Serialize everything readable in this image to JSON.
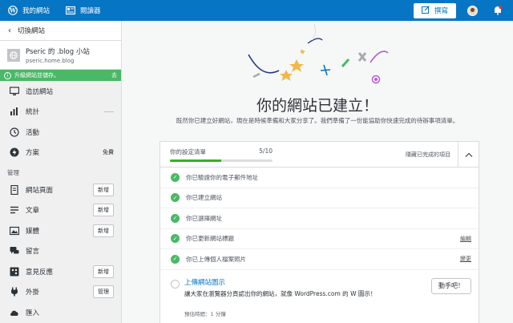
{
  "masterbar": {
    "my_site": "我的網站",
    "reader": "閱讀器",
    "write": "撰寫"
  },
  "sidebar": {
    "switch_site": "切換網站",
    "site_name": "Pseric 的 .blog 小站",
    "site_url": "pseric.home.blog",
    "upgrade_label": "升級網站並儲存。",
    "upgrade_action": "去",
    "items_top": [
      {
        "label": "造訪網站",
        "icon": "monitor-icon"
      },
      {
        "label": "統計",
        "icon": "stats-icon"
      },
      {
        "label": "活動",
        "icon": "activity-icon"
      },
      {
        "label": "方案",
        "icon": "plans-icon",
        "badge": "免費"
      }
    ],
    "manage_heading": "管理",
    "items_manage": [
      {
        "label": "網站頁面",
        "icon": "pages-icon",
        "button": "新增"
      },
      {
        "label": "文章",
        "icon": "posts-icon",
        "button": "新增"
      },
      {
        "label": "媒體",
        "icon": "media-icon",
        "button": "新增"
      },
      {
        "label": "留言",
        "icon": "comments-icon"
      },
      {
        "label": "意見反應",
        "icon": "feedback-icon",
        "button": "新增"
      },
      {
        "label": "外掛",
        "icon": "plugins-icon",
        "button": "管理"
      },
      {
        "label": "匯入",
        "icon": "import-icon"
      }
    ]
  },
  "main": {
    "headline": "你的網站已建立！",
    "subline": "既然你已建立好網站，現在是時候準備和大家分享了。我們準備了一份能協助你快速完成的待辦事項清單。",
    "checklist": {
      "title": "你的設定清單",
      "progress_text": "5/10",
      "progress_fraction": 0.5,
      "hide_label": "隱藏已完成的項目",
      "tasks_done": [
        {
          "text": "你已驗證你的電子郵件地址",
          "action": ""
        },
        {
          "text": "你已建立網站",
          "action": ""
        },
        {
          "text": "你已選擇網址",
          "action": ""
        },
        {
          "text": "你已更新網站標題",
          "action": "編輯"
        },
        {
          "text": "你已上傳個人檔案照片",
          "action": "變更"
        }
      ],
      "next_task": {
        "title": "上傳網站圖示",
        "desc": "讓大家在瀏覽器分頁認出你的網站，就像 WordPress.com 的 W 圖示！",
        "time": "預估時間：1 分鐘",
        "button": "動手吧！"
      }
    }
  },
  "colors": {
    "brand": "#0675c4",
    "success": "#4ab866",
    "progress": "#2fb41f"
  }
}
